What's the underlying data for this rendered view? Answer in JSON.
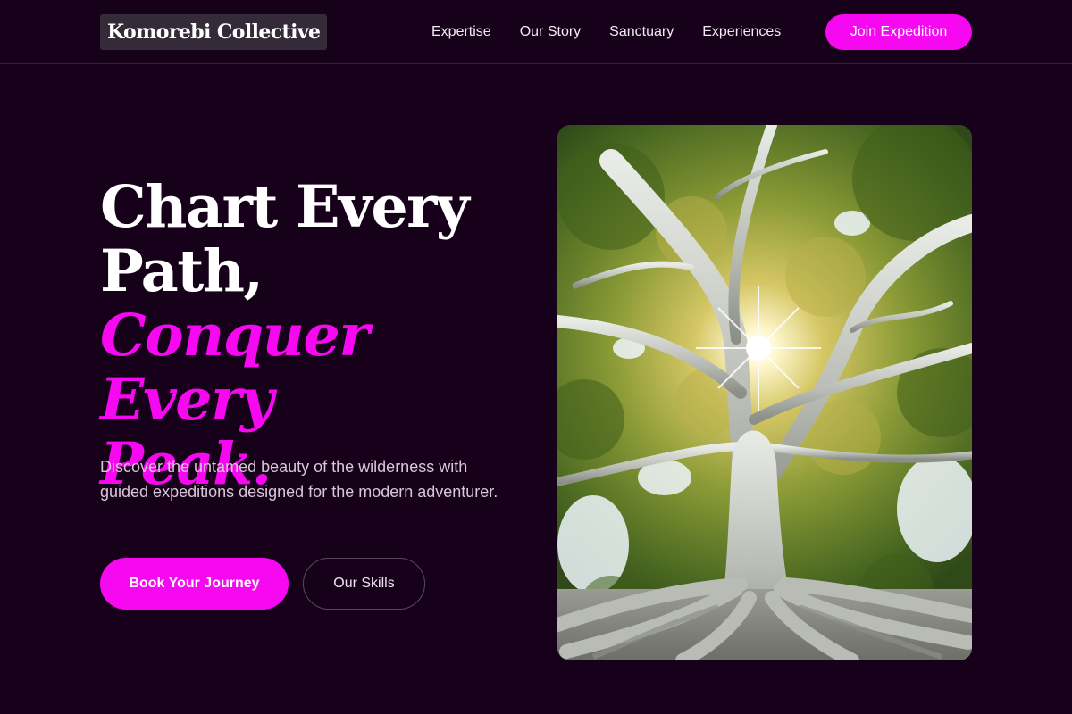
{
  "brand": {
    "name": "Komorebi Collective"
  },
  "nav": {
    "links": [
      "Expertise",
      "Our Story",
      "Sanctuary",
      "Experiences"
    ],
    "cta_label": "Join Expedition"
  },
  "hero": {
    "headline_line1": "Chart Every",
    "headline_line2": "Path,",
    "headline_accent_line1": "Conquer Every",
    "headline_accent_line2": "Peak.",
    "description": "Discover the untamed beauty of the wilderness with guided expeditions designed for the modern adventurer.",
    "primary_button": "Book Your Journey",
    "secondary_button": "Our Skills",
    "image_subject": "banyan tree with sunburst through canopy"
  },
  "colors": {
    "background": "#170019",
    "accent": "#f608f0",
    "text": "#ffffff",
    "muted_text": "#d7c7d8"
  }
}
